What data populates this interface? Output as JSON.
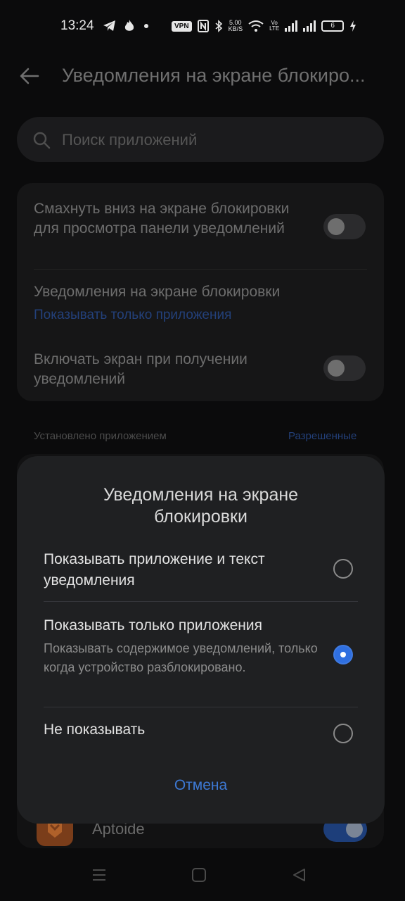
{
  "status_bar": {
    "time": "13:24",
    "vpn": "VPN",
    "speed_value": "5.00",
    "speed_unit": "KB/S",
    "volte_top": "Vo",
    "volte_bottom": "LTE",
    "battery": "6",
    "icons": [
      "telegram-icon",
      "fire-icon",
      "dot-icon",
      "vpn-icon",
      "nfc-icon",
      "bluetooth-icon",
      "wifi-icon",
      "signal-icon",
      "battery-icon",
      "charging-icon"
    ]
  },
  "header": {
    "title": "Уведомления на экране блокиро..."
  },
  "search": {
    "placeholder": "Поиск приложений"
  },
  "settings": {
    "swipe_label": "Смахнуть вниз на экране блокировки для просмотра панели уведомлений",
    "swipe_on": false,
    "lock_notif_label": "Уведомления на экране блокировки",
    "lock_notif_value": "Показывать только приложения",
    "wake_label": "Включать экран при получении уведомлений",
    "wake_on": false
  },
  "section": {
    "label": "Установлено приложением",
    "filter": "Разрешенные"
  },
  "apps": [
    {
      "name": "Aptoide",
      "enabled": true
    }
  ],
  "dialog": {
    "title": "Уведомления на экране блокировки",
    "options": [
      {
        "title": "Показывать приложение и текст уведомления",
        "desc": "",
        "selected": false
      },
      {
        "title": "Показывать только приложения",
        "desc": "Показывать содержимое уведомлений, только когда устройство разблокировано.",
        "selected": true
      },
      {
        "title": "Не показывать",
        "desc": "",
        "selected": false
      }
    ],
    "cancel": "Отмена"
  },
  "colors": {
    "accent": "#2f6fe0",
    "link_dim": "#23407a",
    "dialog_bg": "#1f2022"
  }
}
